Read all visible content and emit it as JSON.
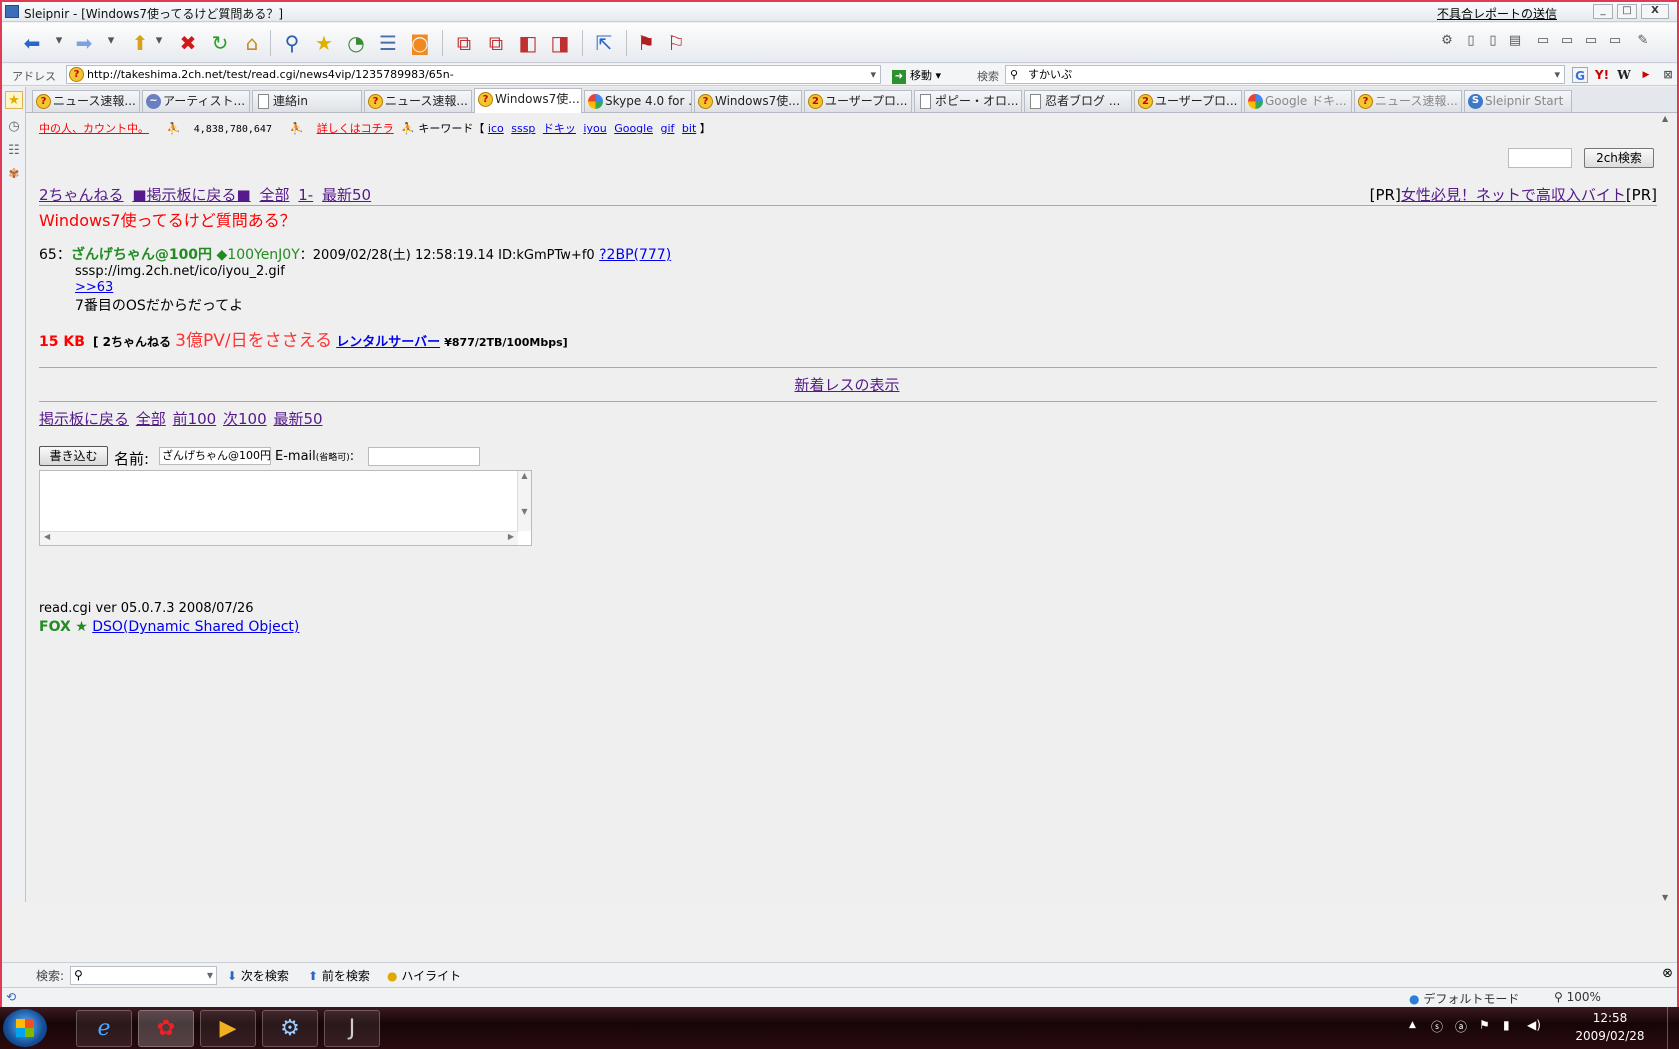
{
  "window": {
    "title": "Sleipnir - [Windows7使ってるけど質問ある？]",
    "report_link": "不具合レポートの送信",
    "min": "_",
    "max": "□",
    "close": "X"
  },
  "address_bar": {
    "label": "アドレス",
    "url": "http://takeshima.2ch.net/test/read.cgi/news4vip/1235789983/65n-",
    "go_label": "移動",
    "search_label": "検索",
    "search_value": "すかいぷ"
  },
  "tabs": [
    {
      "label": "ニュース速報...",
      "icon": "2ch-icon"
    },
    {
      "label": "アーティスト...",
      "icon": "artist-icon"
    },
    {
      "label": "連絡in",
      "icon": "document-icon"
    },
    {
      "label": "ニュース速報...",
      "icon": "2ch-icon"
    },
    {
      "label": "Windows7使...",
      "icon": "2ch-icon",
      "active": true
    },
    {
      "label": "Skype 4.0 for ...",
      "icon": "google-icon"
    },
    {
      "label": "Windows7使...",
      "icon": "2ch-icon"
    },
    {
      "label": "ユーザープロ...",
      "icon": "2ch-icon"
    },
    {
      "label": "ポピー・オロ...",
      "icon": "document-icon"
    },
    {
      "label": "忍者ブログ ...",
      "icon": "document-icon"
    },
    {
      "label": "ユーザープロ...",
      "icon": "2ch-icon"
    },
    {
      "label": "Google ドキ...",
      "icon": "google-icon"
    },
    {
      "label": "ニュース速報...",
      "icon": "2ch-icon"
    },
    {
      "label": "Sleipnir Start",
      "icon": "sleipnir-icon"
    }
  ],
  "page": {
    "counter_label": "中の人、カウント中。",
    "counter_value": "4,838,780,647",
    "details_link": "詳しくはコチラ",
    "keyword_label": "キーワード【",
    "keywords": [
      "ico",
      "sssp",
      "ドキッ",
      "iyou",
      "Google",
      "gif",
      "bit"
    ],
    "keyword_close": "】",
    "search_button": "2ch検索",
    "nav_2ch": "2ちゃんねる",
    "nav_back": "■掲示板に戻る■",
    "nav_all": "全部",
    "nav_1": "1-",
    "nav_latest": "最新50",
    "pr_left": "[PR]",
    "pr_link": "女性必見！ネットで高収入バイト",
    "pr_right": "[PR]",
    "thread_title": "Windows7使ってるけど質問ある？",
    "post": {
      "number": "65",
      "separator": "：",
      "name": "ざんげちゃん@100円",
      "trip": "◆100YenJ0Y",
      "meta": "：2009/02/28(土) 12:58:19.14 ID:kGmPTw+f0",
      "be_link": "?2BP(777)",
      "line1": "sssp://img.2ch.net/ico/iyou_2.gif",
      "anchor": ">>63",
      "line2": "7番目のOSだからだってよ"
    },
    "size": "15 KB",
    "ad_bracket": "[",
    "ad_2ch": "2ちゃんねる",
    "ad_catch": "3億PV/日をささえる",
    "ad_link": "レンタルサーバー",
    "ad_price": "¥877/2TB/100Mbps",
    "ad_close": "]",
    "new_responses": "新着レスの表示",
    "bottom_nav": {
      "back": "掲示板に戻る",
      "all": "全部",
      "prev": "前100",
      "next": "次100",
      "latest": "最新50"
    },
    "form": {
      "submit": "書き込む",
      "name_label": "名前:",
      "name_value": "ざんげちゃん@100円",
      "email_label": "E-mail",
      "email_note": "(省略可)",
      "email_colon": ":"
    },
    "footer_version": "read.cgi ver 05.0.7.3 2008/07/26",
    "footer_fox": "FOX",
    "footer_star": "★",
    "footer_link": "DSO(Dynamic Shared Object)"
  },
  "find_bar": {
    "label": "検索:",
    "next": "次を検索",
    "prev": "前を検索",
    "highlight": "ハイライト"
  },
  "status_bar": {
    "mode": "デフォルトモード",
    "zoom": "100%"
  },
  "taskbar": {
    "time": "12:58",
    "date": "2009/02/28"
  },
  "colors": {
    "accent_border": "#e03a56",
    "link": "#0000ee",
    "visited": "#551a8b",
    "title_red": "#ff0000",
    "name_green": "#228b22"
  }
}
